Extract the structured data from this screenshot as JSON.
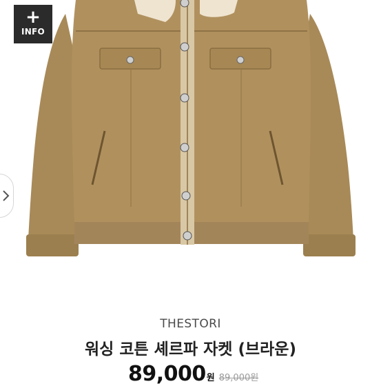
{
  "info_button": {
    "icon": "plus-icon",
    "label": "INFO"
  },
  "navigation": {
    "prev_icon": "chevron-right-icon"
  },
  "product": {
    "brand": "THESTORI",
    "name": "워싱 코튼 셰르파 자켓 (브라운)",
    "price": "89,000",
    "price_unit": "원",
    "original_price": "89,000원"
  },
  "colors": {
    "jacket": "#b0915e",
    "collar": "#efe4d0",
    "info_bg": "#2b2b2b"
  }
}
